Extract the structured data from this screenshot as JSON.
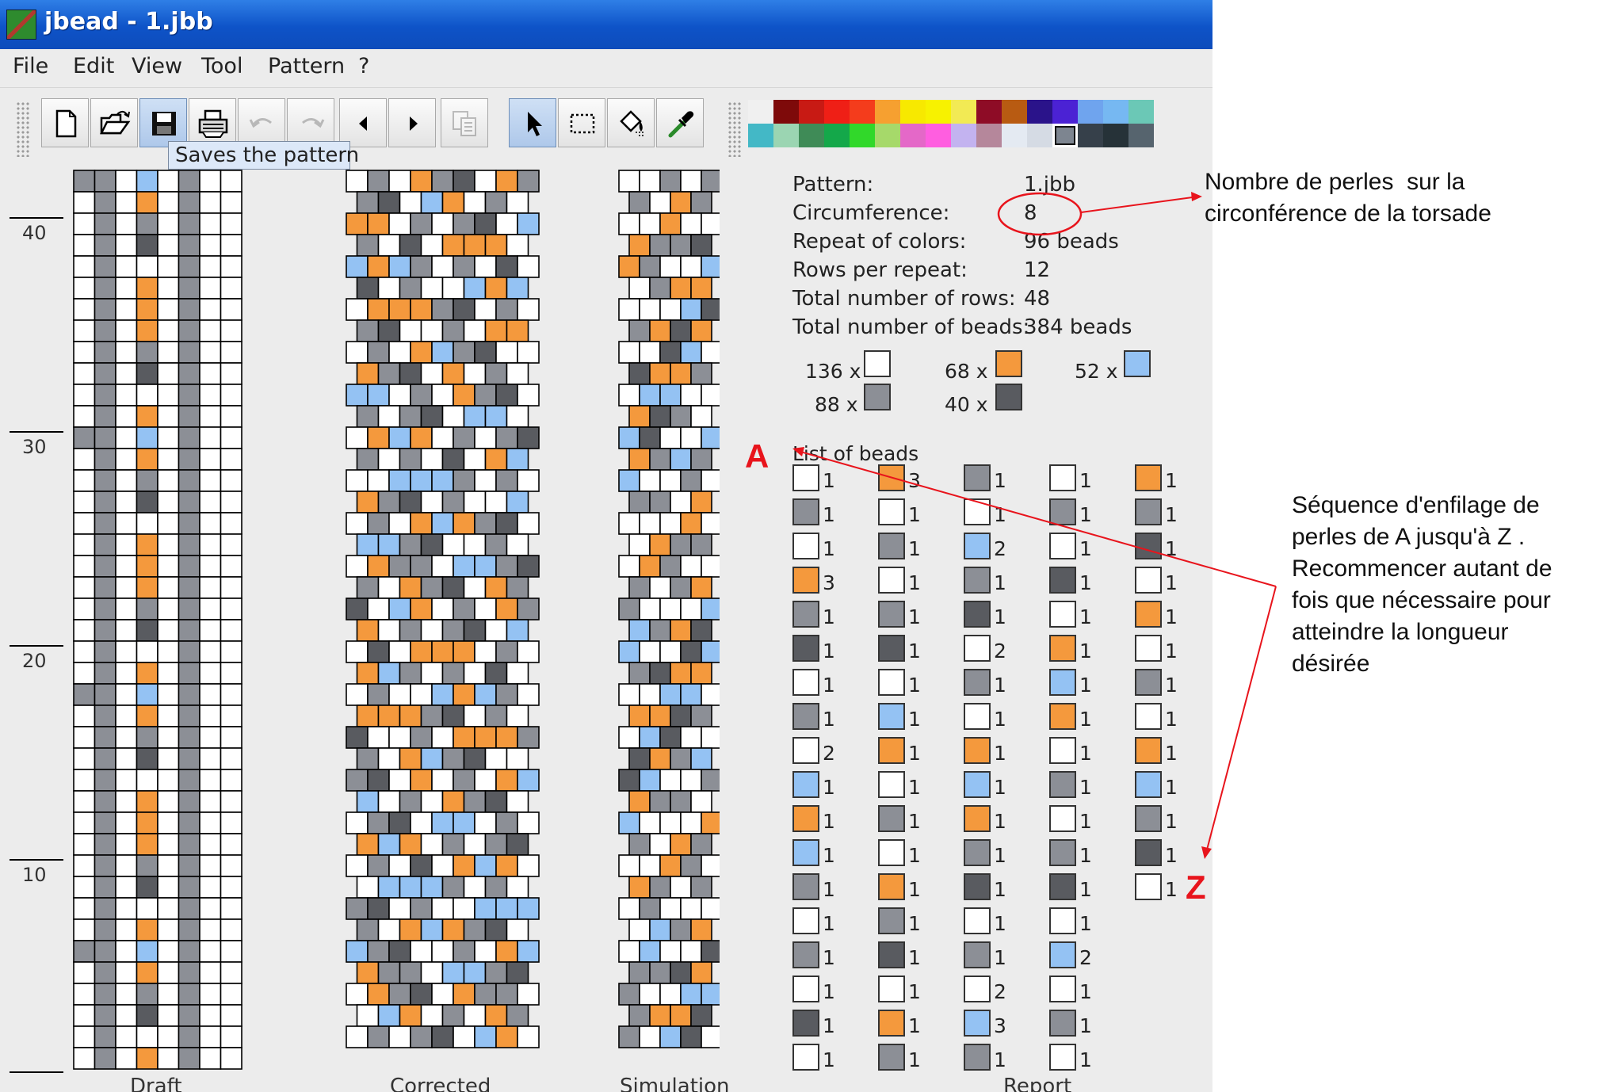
{
  "window": {
    "title": "jbead - 1.jbb"
  },
  "menu": {
    "items": [
      "File",
      "Edit",
      "View",
      "Tool",
      "Pattern",
      "?"
    ]
  },
  "toolbar": {
    "buttons": [
      {
        "name": "new-icon",
        "enabled": true
      },
      {
        "name": "open-icon",
        "enabled": true
      },
      {
        "name": "save-icon",
        "enabled": true
      },
      {
        "name": "print-icon",
        "enabled": true
      },
      {
        "name": "undo-icon",
        "enabled": false
      },
      {
        "name": "redo-icon",
        "enabled": false
      },
      {
        "name": "arrow-left-icon",
        "enabled": true
      },
      {
        "name": "arrow-right-icon",
        "enabled": true
      },
      {
        "name": "copy-icon",
        "enabled": false
      },
      {
        "name": "pointer-icon",
        "enabled": true,
        "active": true
      },
      {
        "name": "select-rect-icon",
        "enabled": true
      },
      {
        "name": "fill-icon",
        "enabled": true
      },
      {
        "name": "pipette-icon",
        "enabled": true
      }
    ],
    "tooltip": "Saves the pattern"
  },
  "palette": {
    "row1": [
      "#f0f0f0",
      "#7e0a0a",
      "#c81a14",
      "#ef1f16",
      "#f43c1c",
      "#f6a030",
      "#f7e900",
      "#f7f200",
      "#f2ea54",
      "#8e0c26",
      "#b85b12",
      "#2a138a",
      "#4b22d4",
      "#6fa4ee",
      "#76b8f2",
      "#6bc8b6"
    ],
    "row2": [
      "#43b8c6",
      "#9bd5b2",
      "#3f8b57",
      "#14a84a",
      "#31d82a",
      "#a6d96a",
      "#e468c8",
      "#ff5ee0",
      "#c3b3f0",
      "#b5879b",
      "#e4eaf2",
      "#d5dbe4",
      "#7d8590",
      "#36404a",
      "#263238",
      "#56646e"
    ],
    "selected_index": 28
  },
  "bead_colors": {
    "W": "#ffffff",
    "G": "#8c8f96",
    "D": "#595b60",
    "O": "#f4993d",
    "B": "#94c2f3"
  },
  "ruler": {
    "labels": [
      "40",
      "30",
      "20",
      "10"
    ]
  },
  "panels": {
    "draft": "Draft",
    "corrected": "Corrected",
    "simulation": "Simulation",
    "report": "Report"
  },
  "info": {
    "pattern_label": "Pattern:",
    "pattern_value": "1.jbb",
    "circumference_label": "Circumference:",
    "circumference_value": "8",
    "repeat_label": "Repeat of colors:",
    "repeat_value": "96 beads",
    "rows_per_repeat_label": "Rows per repeat:",
    "rows_per_repeat_value": "12",
    "total_rows_label": "Total number of rows:",
    "total_rows_value": "48",
    "total_beads_label": "Total number of beads:",
    "total_beads_value": "384 beads"
  },
  "bead_counts": [
    {
      "count": "136 x",
      "color": "W"
    },
    {
      "count": "68 x",
      "color": "O"
    },
    {
      "count": "52 x",
      "color": "B"
    },
    {
      "count": "88 x",
      "color": "G"
    },
    {
      "count": "40 x",
      "color": "D"
    }
  ],
  "list_of_beads_label": "List of beads",
  "bead_list_columns": [
    [
      [
        "W",
        "1"
      ],
      [
        "G",
        "1"
      ],
      [
        "W",
        "1"
      ],
      [
        "O",
        "3"
      ],
      [
        "G",
        "1"
      ],
      [
        "D",
        "1"
      ],
      [
        "W",
        "1"
      ],
      [
        "G",
        "1"
      ],
      [
        "W",
        "2"
      ],
      [
        "B",
        "1"
      ],
      [
        "O",
        "1"
      ],
      [
        "B",
        "1"
      ],
      [
        "G",
        "1"
      ],
      [
        "W",
        "1"
      ],
      [
        "G",
        "1"
      ],
      [
        "W",
        "1"
      ],
      [
        "D",
        "1"
      ],
      [
        "W",
        "1"
      ]
    ],
    [
      [
        "O",
        "3"
      ],
      [
        "W",
        "1"
      ],
      [
        "G",
        "1"
      ],
      [
        "W",
        "1"
      ],
      [
        "G",
        "1"
      ],
      [
        "D",
        "1"
      ],
      [
        "W",
        "1"
      ],
      [
        "B",
        "1"
      ],
      [
        "O",
        "1"
      ],
      [
        "W",
        "1"
      ],
      [
        "G",
        "1"
      ],
      [
        "W",
        "1"
      ],
      [
        "O",
        "1"
      ],
      [
        "G",
        "1"
      ],
      [
        "D",
        "1"
      ],
      [
        "W",
        "1"
      ],
      [
        "O",
        "1"
      ],
      [
        "G",
        "1"
      ]
    ],
    [
      [
        "G",
        "1"
      ],
      [
        "W",
        "1"
      ],
      [
        "B",
        "2"
      ],
      [
        "G",
        "1"
      ],
      [
        "D",
        "1"
      ],
      [
        "W",
        "2"
      ],
      [
        "G",
        "1"
      ],
      [
        "W",
        "1"
      ],
      [
        "O",
        "1"
      ],
      [
        "B",
        "1"
      ],
      [
        "O",
        "1"
      ],
      [
        "G",
        "1"
      ],
      [
        "D",
        "1"
      ],
      [
        "W",
        "1"
      ],
      [
        "G",
        "1"
      ],
      [
        "W",
        "2"
      ],
      [
        "B",
        "3"
      ],
      [
        "G",
        "1"
      ]
    ],
    [
      [
        "W",
        "1"
      ],
      [
        "G",
        "1"
      ],
      [
        "W",
        "1"
      ],
      [
        "D",
        "1"
      ],
      [
        "W",
        "1"
      ],
      [
        "O",
        "1"
      ],
      [
        "B",
        "1"
      ],
      [
        "O",
        "1"
      ],
      [
        "W",
        "1"
      ],
      [
        "G",
        "1"
      ],
      [
        "W",
        "1"
      ],
      [
        "G",
        "1"
      ],
      [
        "D",
        "1"
      ],
      [
        "W",
        "1"
      ],
      [
        "B",
        "2"
      ],
      [
        "W",
        "1"
      ],
      [
        "G",
        "1"
      ],
      [
        "W",
        "1"
      ]
    ],
    [
      [
        "O",
        "1"
      ],
      [
        "G",
        "1"
      ],
      [
        "D",
        "1"
      ],
      [
        "W",
        "1"
      ],
      [
        "O",
        "1"
      ],
      [
        "W",
        "1"
      ],
      [
        "G",
        "1"
      ],
      [
        "W",
        "1"
      ],
      [
        "O",
        "1"
      ],
      [
        "B",
        "1"
      ],
      [
        "G",
        "1"
      ],
      [
        "D",
        "1"
      ],
      [
        "W",
        "1"
      ]
    ]
  ],
  "annotations": {
    "top_note": "Nombre de perles  sur la\ncirconférence de la torsade",
    "side_note": "Séquence d'enfilage de\nperles de A jusqu'à Z .\nRecommencer autant de\nfois que nécessaire pour\natteindre la longueur\ndésirée",
    "letter_a": "A",
    "letter_z": "Z"
  }
}
